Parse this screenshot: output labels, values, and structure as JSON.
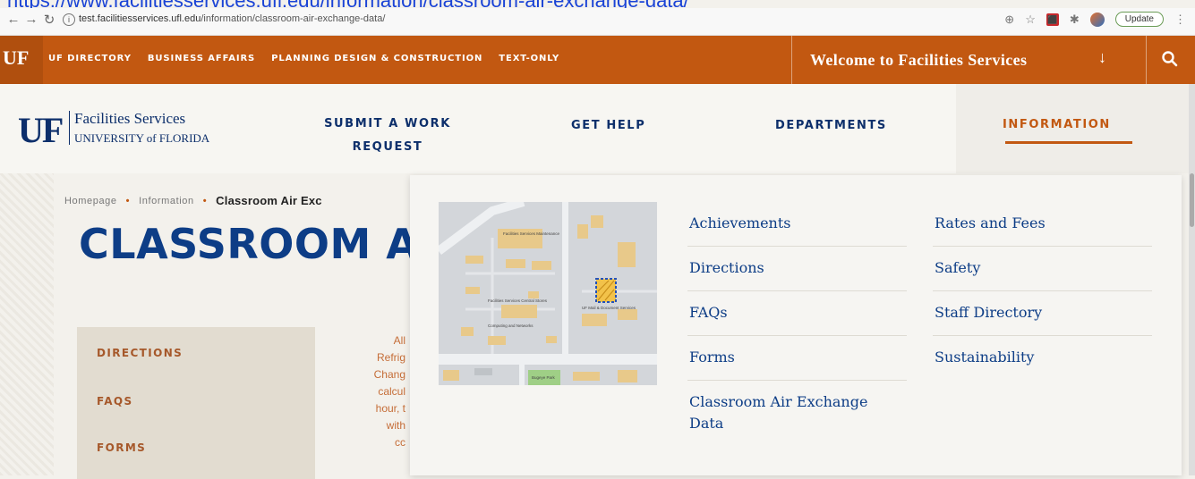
{
  "url_caption": "https://www.facilitiesservices.ufl.edu/information/classroom-air-exchange-data/",
  "browser": {
    "address_host": "test.facilitiesservices.ufl.edu",
    "address_path": "/information/classroom-air-exchange-data/",
    "update_label": "Update",
    "icons": [
      "back-arrow-icon",
      "forward-arrow-icon",
      "reload-icon",
      "info-icon",
      "zoom-icon",
      "star-icon",
      "pdf-extension-icon",
      "puzzle-extension-icon",
      "profile-avatar",
      "menu-dots-icon"
    ]
  },
  "topbar": {
    "logo": "UF",
    "links": [
      "UF DIRECTORY",
      "BUSINESS AFFAIRS",
      "PLANNING DESIGN & CONSTRUCTION",
      "TEXT-ONLY"
    ],
    "welcome": "Welcome to Facilities Services",
    "accent_color": "#c25811"
  },
  "logo": {
    "mark": "UF",
    "line1": "Facilities Services",
    "line2": "UNIVERSITY of FLORIDA"
  },
  "nav": {
    "submit_line1": "SUBMIT A WORK",
    "submit_line2": "REQUEST",
    "get_help": "GET HELP",
    "departments": "DEPARTMENTS",
    "information": "INFORMATION"
  },
  "breadcrumb": {
    "home": "Homepage",
    "information": "Information",
    "current": "Classroom Air Exc"
  },
  "page": {
    "title": "CLASSROOM A",
    "brand_blue": "#0d3d86"
  },
  "sidebar": {
    "items": [
      "DIRECTIONS",
      "FAQS",
      "FORMS"
    ]
  },
  "body_text": [
    "All",
    "Refrig",
    "Chang",
    "calcul",
    "hour, t",
    "with",
    "cc"
  ],
  "dropdown": {
    "col1": [
      "Achievements",
      "Directions",
      "FAQs",
      "Forms",
      "Classroom Air Exchange Data"
    ],
    "col2": [
      "Rates and Fees",
      "Safety",
      "Staff Directory",
      "Sustainability"
    ],
    "map_labels": {
      "a": "Facilities Services Maintenance",
      "b": "Facilities Services Central Stores",
      "c": "Computing and Networks",
      "d": "UF Mail & Document Services",
      "e": "Bugeye Park"
    }
  }
}
